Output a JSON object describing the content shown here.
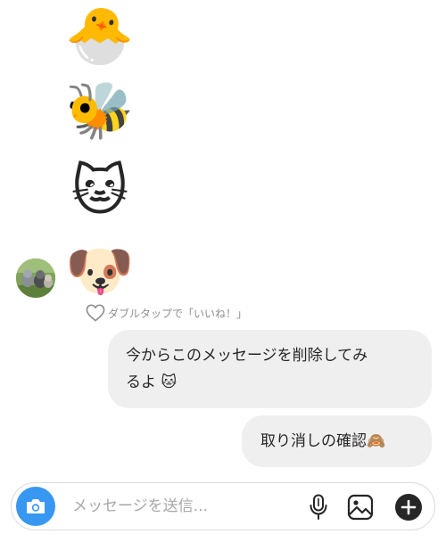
{
  "messages": {
    "emoji_1": "🐣",
    "emoji_2": "🐝",
    "emoji_3": "🐱",
    "emoji_4": "🐶",
    "double_tap_hint": "ダブルタップで「いいね！」",
    "bubble_1_line_1": "今からこのメッセージを削除してみ",
    "bubble_1_line_2": "るよ",
    "bubble_1_emoji": "🐱",
    "bubble_2_text": "取り消しの確認",
    "bubble_2_emoji": "🙈"
  },
  "composer": {
    "placeholder": "メッセージを送信..."
  },
  "icons": {
    "camera": "camera-icon",
    "mic": "microphone-icon",
    "gallery": "image-icon",
    "plus": "plus-circle-icon",
    "heart": "heart-outline-icon"
  },
  "colors": {
    "accent": "#3897f0",
    "bubble": "#efefef",
    "hint_text": "#8e8e8e",
    "placeholder_text": "#a8a8a8"
  }
}
